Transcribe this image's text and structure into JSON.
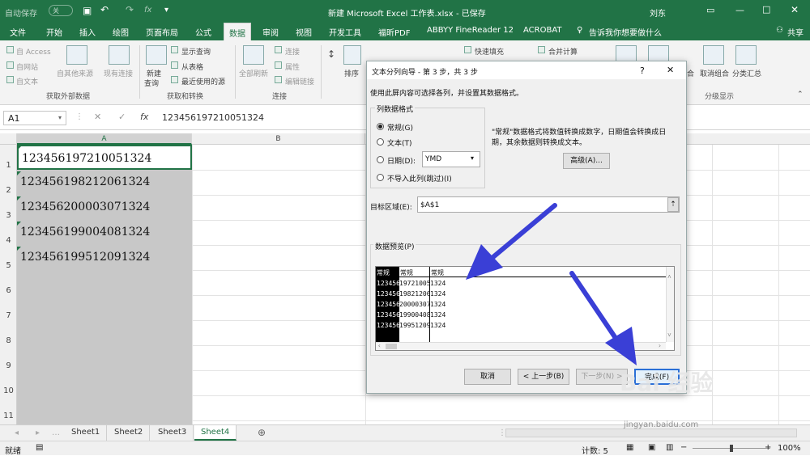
{
  "titlebar": {
    "autosave_label": "自动保存",
    "autosave_state": "关",
    "document_title": "新建 Microsoft Excel 工作表.xlsx",
    "save_status": "- 已保存",
    "user_name": "刘东"
  },
  "ribbon_tabs": [
    "文件",
    "开始",
    "插入",
    "绘图",
    "页面布局",
    "公式",
    "数据",
    "审阅",
    "视图",
    "开发工具",
    "福昕PDF",
    "ABBYY FineReader 12",
    "ACROBAT"
  ],
  "tell_me": "告诉我你想要做什么",
  "share_label": "共享",
  "ribbon": {
    "access": "自 Access",
    "web": "自网站",
    "text": "自文本",
    "other_sources": "自其他来源",
    "existing_connections": "现有连接",
    "group_external": "获取外部数据",
    "new_query": "新建",
    "new_query2": "查询",
    "show_queries": "显示查询",
    "from_table": "从表格",
    "recent_sources": "最近使用的源",
    "group_transform": "获取和转换",
    "refresh_all": "全部刷新",
    "connections": "连接",
    "properties": "属性",
    "edit_links": "编辑链接",
    "group_connections": "连接",
    "sort": "排序",
    "flash_fill": "快速填充",
    "consolidate": "合并计算",
    "ungroup": "取消组合",
    "subtotal": "分类汇总",
    "group_outline": "分级显示",
    "group_label_short": "合"
  },
  "formula_bar": {
    "name_box": "A1",
    "formula": "123456197210051324"
  },
  "columns": [
    "A",
    "B"
  ],
  "rows": [
    "1",
    "2",
    "3",
    "4",
    "5",
    "6",
    "7",
    "8",
    "9",
    "10",
    "11"
  ],
  "cells": [
    "123456197210051324",
    "123456198212061324",
    "123456200003071324",
    "123456199004081324",
    "123456199512091324"
  ],
  "sheets": [
    "Sheet1",
    "Sheet2",
    "Sheet3",
    "Sheet4"
  ],
  "active_sheet": "Sheet4",
  "status": {
    "ready": "就绪",
    "count": "计数: 5",
    "zoom": "100%"
  },
  "dialog": {
    "title": "文本分列向导 - 第 3 步，共 3 步",
    "help": "?",
    "close": "✕",
    "instruction": "使用此屏内容可选择各列，并设置其数据格式。",
    "format_group": "列数据格式",
    "options": [
      "常规(G)",
      "文本(T)",
      "日期(D):",
      "不导入此列(跳过)(I)"
    ],
    "date_format": "YMD",
    "note": "\"常规\"数据格式将数值转换成数字，日期值会转换成日期，其余数据则转换成文本。",
    "advanced": "高级(A)...",
    "dest_label": "目标区域(E):",
    "dest_value": "$A$1",
    "preview_label": "数据预览(P)",
    "preview_headers": [
      "常规",
      "常规",
      "常规"
    ],
    "preview_rows": [
      [
        "123456",
        "19721005",
        "1324"
      ],
      [
        "123456",
        "19821206",
        "1324"
      ],
      [
        "123456",
        "20000307",
        "1324"
      ],
      [
        "123456",
        "19900408",
        "1324"
      ],
      [
        "123456",
        "19951209",
        "1324"
      ]
    ],
    "buttons": {
      "cancel": "取消",
      "back": "< 上一步(B)",
      "next": "下一步(N) >",
      "finish": "完成(F)"
    }
  },
  "watermark": "Bai 经验",
  "watermark_url": "jingyan.baidu.com",
  "colors": {
    "excel_green": "#217346",
    "annotation_arrow": "#3a3fd6"
  }
}
